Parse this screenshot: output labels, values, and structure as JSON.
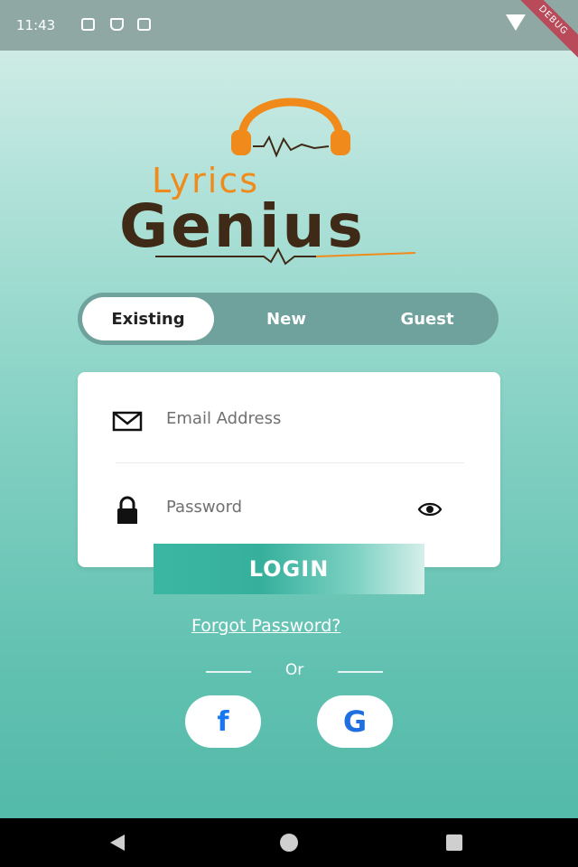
{
  "status_bar": {
    "time": "11:43",
    "icons": [
      "notification-icon",
      "sd-card-icon",
      "cast-icon"
    ],
    "wifi_icon": "wifi-icon",
    "debug_banner": "DEBUG"
  },
  "logo": {
    "line1": "Lyrics",
    "line2": "Genius",
    "icon": "headphones-icon",
    "colors": {
      "orange": "#f08a1a",
      "brown": "#3e2a16"
    }
  },
  "tabs": {
    "items": [
      {
        "label": "Existing",
        "active": true
      },
      {
        "label": "New",
        "active": false
      },
      {
        "label": "Guest",
        "active": false
      }
    ]
  },
  "form": {
    "email_placeholder": "Email Address",
    "email_value": "",
    "password_placeholder": "Password",
    "password_value": "",
    "email_icon": "mail-icon",
    "password_icon": "lock-icon",
    "visibility_icon": "eye-icon"
  },
  "login_button": "LOGIN",
  "forgot_password": "Forgot Password?",
  "divider_text": "Or",
  "social": {
    "facebook_glyph": "f",
    "google_glyph": "G"
  },
  "accent_color": "#3ab7a3"
}
